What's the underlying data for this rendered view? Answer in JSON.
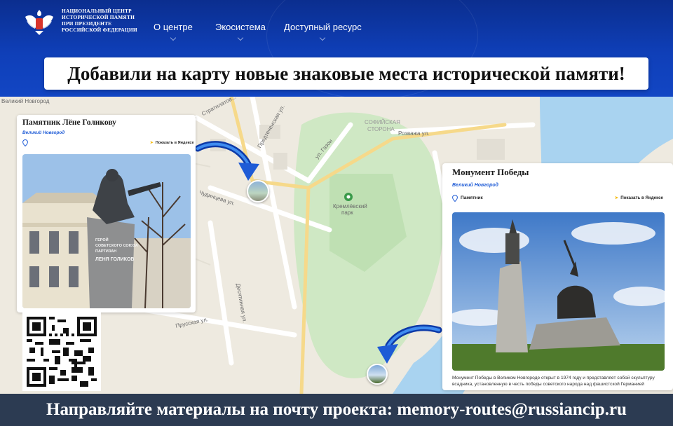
{
  "header": {
    "org_lines": [
      "НАЦИОНАЛЬНЫЙ ЦЕНТР",
      "ИСТОРИЧЕСКОЙ ПАМЯТИ",
      "ПРИ ПРЕЗИДЕНТЕ",
      "РОССИЙСКОЙ ФЕДЕРАЦИИ"
    ],
    "nav": [
      {
        "label": "О центре"
      },
      {
        "label": "Экосистема"
      },
      {
        "label": "Доступный ресурс"
      }
    ],
    "banner": "Добавили на карту новые знаковые места исторической памяти!"
  },
  "map": {
    "labels": {
      "city_top_left": "Великий Новгород",
      "stratilatovskaya": "Стратилатов...",
      "predtechenskaya": "Предтеченская ул.",
      "sofia_1": "СОФИЙСКАЯ",
      "sofia_2": "СТОРОНА",
      "rozvazha": "Розважа ул.",
      "gazon": "ул. Газон",
      "chudintseva": "Чудинцева ул.",
      "kremlin_1": "Кремлёвский",
      "kremlin_2": "парк",
      "prusskaya": "Прусская ул.",
      "desyatinnaya": "Десятинная ул."
    }
  },
  "card_left": {
    "title": "Памятник Лёне Голикову",
    "city": "Великий Новгород",
    "yandex": "Показать в Яндексе",
    "plaque": [
      "ГЕРОЙ",
      "СОВЕТСКОГО СОЮЗА",
      "ПАРТИЗАН",
      "ЛЕНЯ ГОЛИКОВ"
    ]
  },
  "card_right": {
    "title": "Монумент Победы",
    "city": "Великий Новгород",
    "type": "Памятник",
    "yandex": "Показать в Яндексе",
    "caption": "Монумент Победы в Великом Новгороде открыт в 1974 году и представляет собой скульптуру всадника, установленную в честь победы советского народа над фашистской Германией"
  },
  "footer": {
    "text": "Направляйте материалы на почту проекта: memory-routes@russiancip.ru"
  },
  "colors": {
    "header_blue": "#0f3fb8",
    "footer_bg": "#2c3b52",
    "park_green": "#cfe8c4",
    "water": "#a9d3f0",
    "accent_link": "#1e5bd6",
    "yandex_arrow": "#f5b800"
  }
}
